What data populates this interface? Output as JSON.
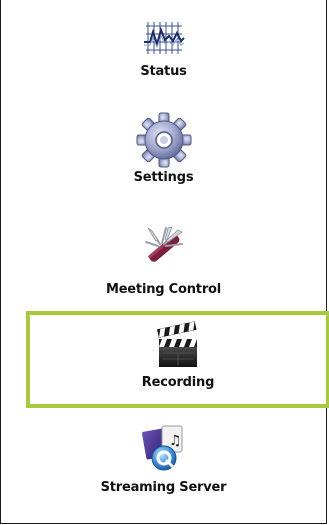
{
  "nav": {
    "accent_color": "#a7c93b",
    "selected": "recording",
    "items": [
      {
        "id": "status",
        "label": "Status",
        "icon": "status-chart-icon"
      },
      {
        "id": "settings",
        "label": "Settings",
        "icon": "gear-icon"
      },
      {
        "id": "meeting-control",
        "label": "Meeting Control",
        "icon": "multitool-knife-icon"
      },
      {
        "id": "recording",
        "label": "Recording",
        "icon": "clapperboard-icon"
      },
      {
        "id": "streaming-server",
        "label": "Streaming Server",
        "icon": "quicktime-media-icon"
      }
    ]
  }
}
